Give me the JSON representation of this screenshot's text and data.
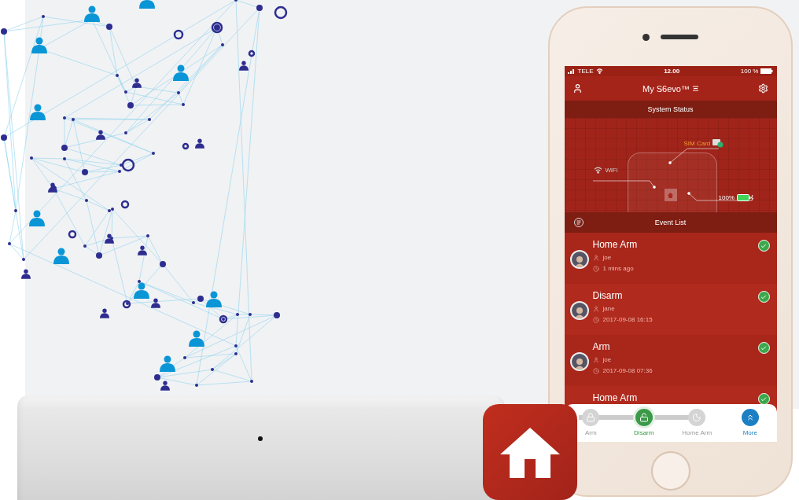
{
  "phone": {
    "status_bar": {
      "carrier": "TELE",
      "time": "12.00",
      "battery": "100 %"
    },
    "header": {
      "title": "My S6evo™"
    },
    "system_status": {
      "title": "System Status",
      "sim_label": "SIM Card",
      "wifi_label": "WiFi",
      "battery_label": "100%"
    },
    "event_list": {
      "title": "Event List",
      "events": [
        {
          "title": "Home Arm",
          "user": "joe",
          "time": "1 mins ago",
          "confirmed": true
        },
        {
          "title": "Disarm",
          "user": "jane",
          "time": "2017-09-08 16:15",
          "confirmed": true
        },
        {
          "title": "Arm",
          "user": "joe",
          "time": "2017-09-08 07:36",
          "confirmed": true
        },
        {
          "title": "Home Arm",
          "confirmed": true
        }
      ]
    },
    "tabs": [
      {
        "label": "Arm",
        "kind": "mode",
        "selected": false
      },
      {
        "label": "Disarm",
        "kind": "mode",
        "selected": true
      },
      {
        "label": "Home Arm",
        "kind": "mode",
        "selected": false
      },
      {
        "label": "More",
        "kind": "more",
        "selected": false
      }
    ]
  }
}
